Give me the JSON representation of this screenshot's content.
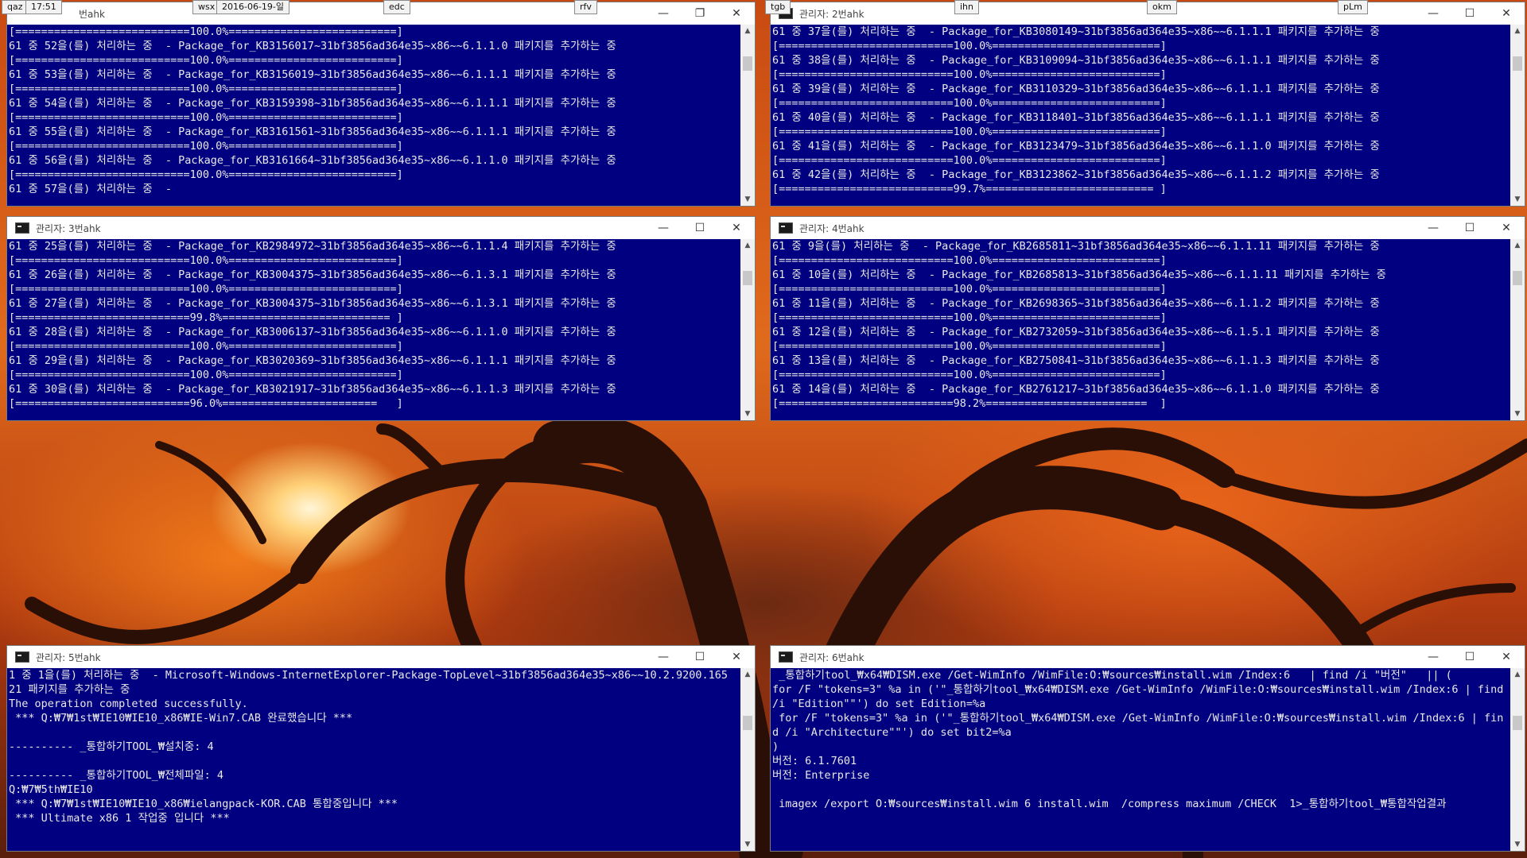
{
  "taskbar": {
    "items": [
      "qaz",
      "17:51",
      "wsx",
      "2016-06-19-일",
      "edc",
      "rfv",
      "tgb",
      "ihn",
      "okm",
      "pLm"
    ]
  },
  "windows": [
    {
      "title": "번ahk",
      "lines": [
        "[===========================100.0%==========================]",
        "61 중 52을(를) 처리하는 중  - Package_for_KB3156017~31bf3856ad364e35~x86~~6.1.1.0 패키지를 추가하는 중",
        "[===========================100.0%==========================]",
        "61 중 53을(를) 처리하는 중  - Package_for_KB3156019~31bf3856ad364e35~x86~~6.1.1.1 패키지를 추가하는 중",
        "[===========================100.0%==========================]",
        "61 중 54을(를) 처리하는 중  - Package_for_KB3159398~31bf3856ad364e35~x86~~6.1.1.1 패키지를 추가하는 중",
        "[===========================100.0%==========================]",
        "61 중 55을(를) 처리하는 중  - Package_for_KB3161561~31bf3856ad364e35~x86~~6.1.1.1 패키지를 추가하는 중",
        "[===========================100.0%==========================]",
        "61 중 56을(를) 처리하는 중  - Package_for_KB3161664~31bf3856ad364e35~x86~~6.1.1.0 패키지를 추가하는 중",
        "[===========================100.0%==========================]",
        "61 중 57을(를) 처리하는 중  -"
      ]
    },
    {
      "title": "관리자: 2번ahk",
      "lines": [
        "61 중 37을(를) 처리하는 중  - Package_for_KB3080149~31bf3856ad364e35~x86~~6.1.1.1 패키지를 추가하는 중",
        "[===========================100.0%==========================]",
        "61 중 38을(를) 처리하는 중  - Package_for_KB3109094~31bf3856ad364e35~x86~~6.1.1.1 패키지를 추가하는 중",
        "[===========================100.0%==========================]",
        "61 중 39을(를) 처리하는 중  - Package_for_KB3110329~31bf3856ad364e35~x86~~6.1.1.1 패키지를 추가하는 중",
        "[===========================100.0%==========================]",
        "61 중 40을(를) 처리하는 중  - Package_for_KB3118401~31bf3856ad364e35~x86~~6.1.1.1 패키지를 추가하는 중",
        "[===========================100.0%==========================]",
        "61 중 41을(를) 처리하는 중  - Package_for_KB3123479~31bf3856ad364e35~x86~~6.1.1.0 패키지를 추가하는 중",
        "[===========================100.0%==========================]",
        "61 중 42을(를) 처리하는 중  - Package_for_KB3123862~31bf3856ad364e35~x86~~6.1.1.2 패키지를 추가하는 중",
        "[===========================99.7%========================== ]"
      ]
    },
    {
      "title": "관리자: 3번ahk",
      "lines": [
        "61 중 25을(를) 처리하는 중  - Package_for_KB2984972~31bf3856ad364e35~x86~~6.1.1.4 패키지를 추가하는 중",
        "[===========================100.0%==========================]",
        "61 중 26을(를) 처리하는 중  - Package_for_KB3004375~31bf3856ad364e35~x86~~6.1.3.1 패키지를 추가하는 중",
        "[===========================100.0%==========================]",
        "61 중 27을(를) 처리하는 중  - Package_for_KB3004375~31bf3856ad364e35~x86~~6.1.3.1 패키지를 추가하는 중",
        "[===========================99.8%========================== ]",
        "61 중 28을(를) 처리하는 중  - Package_for_KB3006137~31bf3856ad364e35~x86~~6.1.1.0 패키지를 추가하는 중",
        "[===========================100.0%==========================]",
        "61 중 29을(를) 처리하는 중  - Package_for_KB3020369~31bf3856ad364e35~x86~~6.1.1.1 패키지를 추가하는 중",
        "[===========================100.0%==========================]",
        "61 중 30을(를) 처리하는 중  - Package_for_KB3021917~31bf3856ad364e35~x86~~6.1.1.3 패키지를 추가하는 중",
        "[===========================96.0%========================   ]"
      ]
    },
    {
      "title": "관리자: 4번ahk",
      "lines": [
        "61 중 9을(를) 처리하는 중  - Package_for_KB2685811~31bf3856ad364e35~x86~~6.1.1.11 패키지를 추가하는 중",
        "[===========================100.0%==========================]",
        "61 중 10을(를) 처리하는 중  - Package_for_KB2685813~31bf3856ad364e35~x86~~6.1.1.11 패키지를 추가하는 중",
        "[===========================100.0%==========================]",
        "61 중 11을(를) 처리하는 중  - Package_for_KB2698365~31bf3856ad364e35~x86~~6.1.1.2 패키지를 추가하는 중",
        "[===========================100.0%==========================]",
        "61 중 12을(를) 처리하는 중  - Package_for_KB2732059~31bf3856ad364e35~x86~~6.1.5.1 패키지를 추가하는 중",
        "[===========================100.0%==========================]",
        "61 중 13을(를) 처리하는 중  - Package_for_KB2750841~31bf3856ad364e35~x86~~6.1.1.3 패키지를 추가하는 중",
        "[===========================100.0%==========================]",
        "61 중 14을(를) 처리하는 중  - Package_for_KB2761217~31bf3856ad364e35~x86~~6.1.1.0 패키지를 추가하는 중",
        "[===========================98.2%=========================  ]"
      ]
    },
    {
      "title": "관리자: 5번ahk",
      "lines": [
        "1 중 1을(를) 처리하는 중  - Microsoft-Windows-InternetExplorer-Package-TopLevel~31bf3856ad364e35~x86~~10.2.9200.165",
        "21 패키지를 추가하는 중",
        "The operation completed successfully.",
        " *** Q:₩7₩1st₩IE10₩IE10_x86₩IE-Win7.CAB 완료했습니다 ***",
        "",
        "---------- _통합하기TOOL_₩설치중: 4",
        "",
        "---------- _통합하기TOOL_₩전체파일: 4",
        "Q:₩7₩5th₩IE10",
        " *** Q:₩7₩1st₩IE10₩IE10_x86₩ielangpack-KOR.CAB 통합중입니다 ***",
        " *** Ultimate x86 1 작업중 입니다 ***"
      ]
    },
    {
      "title": "관리자: 6번ahk",
      "lines": [
        " _통합하기tool_₩x64₩DISM.exe /Get-WimInfo /WimFile:O:₩sources₩install.wim /Index:6   | find /i \"버전\"   || (",
        "for /F \"tokens=3\" %a in ('\"_통합하기tool_₩x64₩DISM.exe /Get-WimInfo /WimFile:O:₩sources₩install.wim /Index:6 | find",
        "/i \"Edition\"\"') do set Edition=%a",
        " for /F \"tokens=3\" %a in ('\"_통합하기tool_₩x64₩DISM.exe /Get-WimInfo /WimFile:O:₩sources₩install.wim /Index:6 | fin",
        "d /i \"Architecture\"\"') do set bit2=%a",
        ")",
        "버전: 6.1.7601",
        "버전: Enterprise",
        "",
        " imagex /export O:₩sources₩install.wim 6 install.wim  /compress maximum /CHECK  1>_통합하기tool_₩통합작업결과"
      ]
    }
  ]
}
